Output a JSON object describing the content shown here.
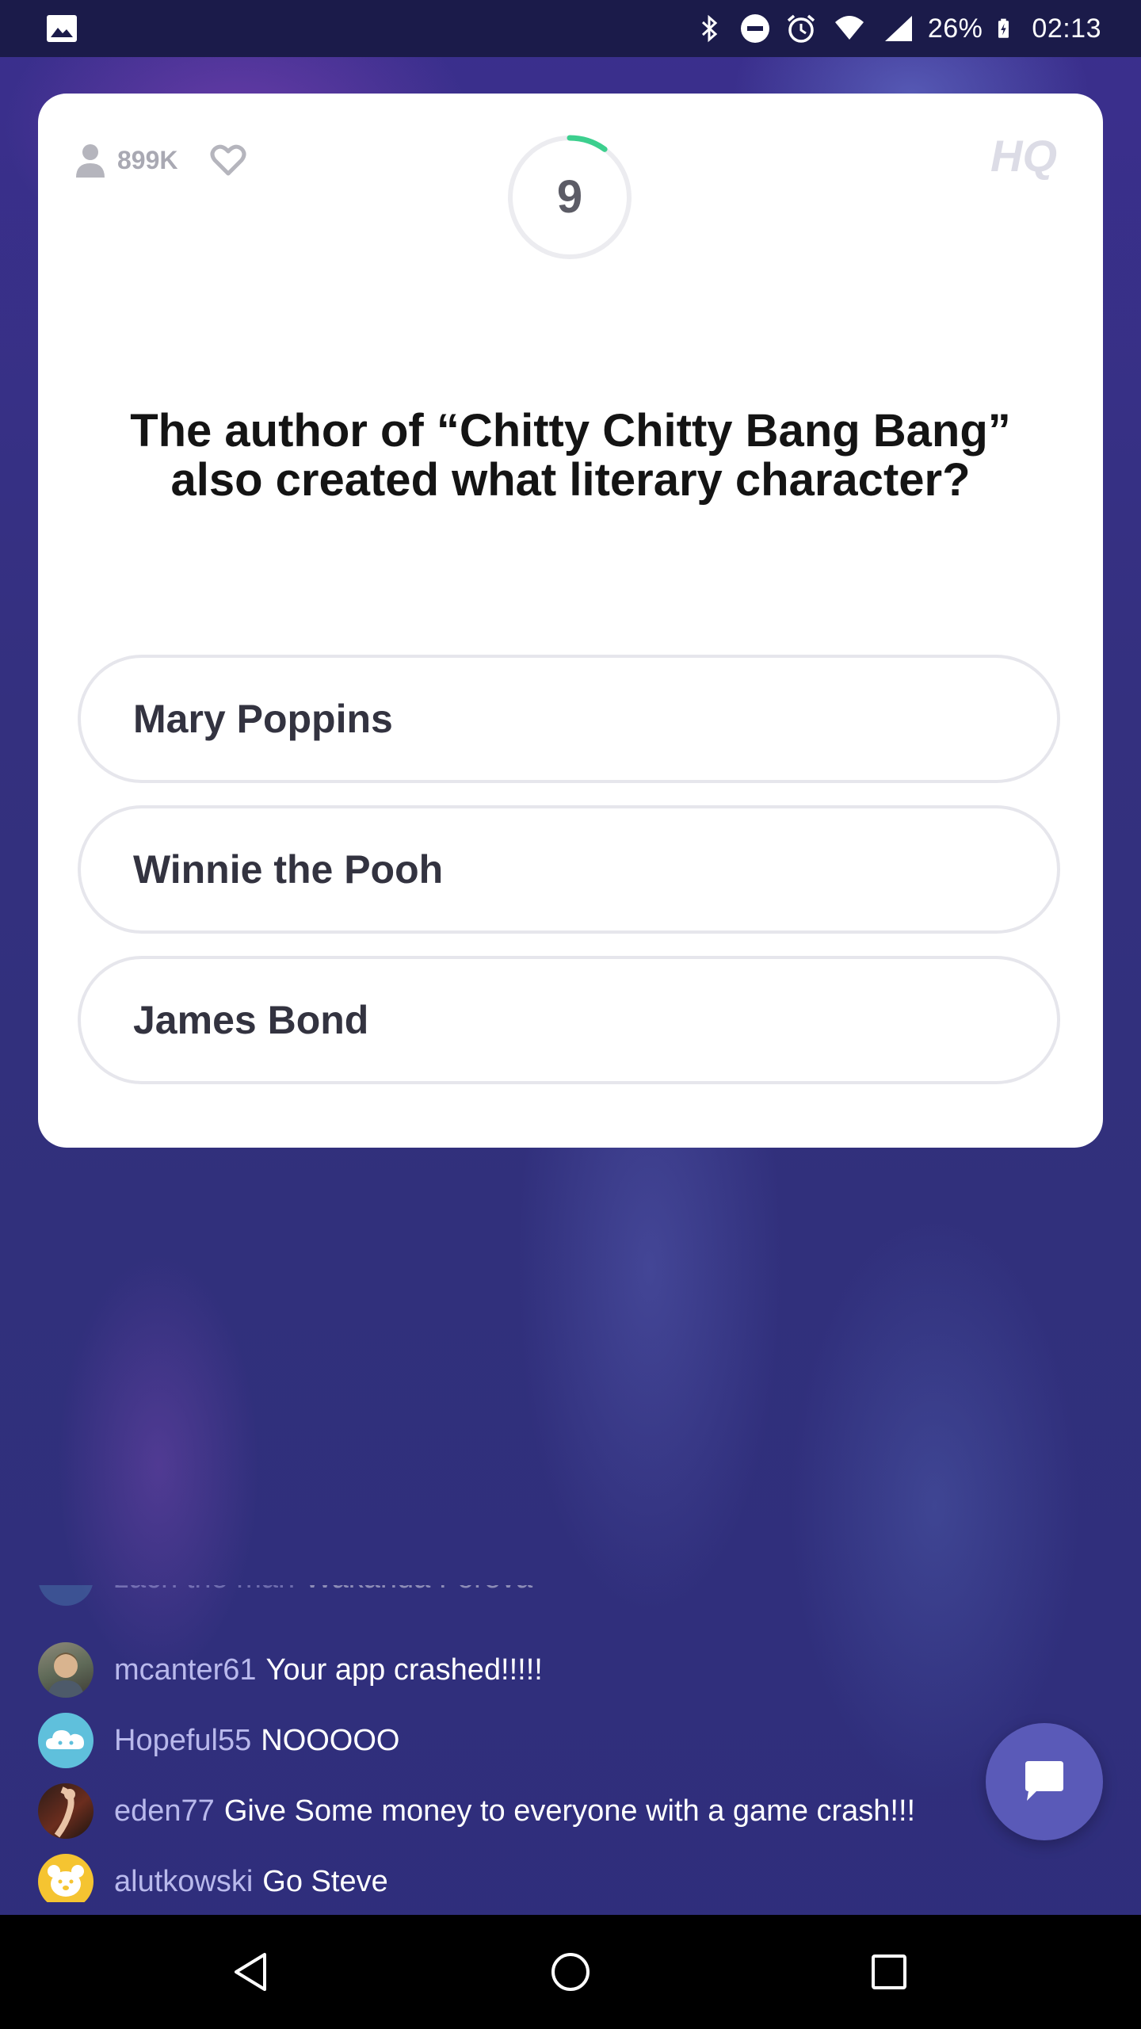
{
  "status_bar": {
    "battery_percent": "26%",
    "time": "02:13",
    "icons": [
      "gallery-icon",
      "bluetooth-icon",
      "do-not-disturb-icon",
      "alarm-icon",
      "wifi-icon",
      "cell-signal-icon",
      "battery-charging-icon"
    ]
  },
  "card": {
    "player_count": "899K",
    "timer": "9",
    "timer_progress": 0.1,
    "logo_text": "HQ",
    "question": "The author of “Chitty Chitty Bang Bang” also created what literary character?",
    "answers": [
      {
        "label": "Mary Poppins"
      },
      {
        "label": "Winnie the Pooh"
      },
      {
        "label": "James Bond"
      }
    ]
  },
  "chat": {
    "messages": [
      {
        "user": "zach the man",
        "text": "Wakanda Foreva"
      },
      {
        "user": "mcanter61",
        "text": "Your app crashed!!!!!"
      },
      {
        "user": "Hopeful55",
        "text": "NOOOOO"
      },
      {
        "user": "eden77",
        "text": "Give Some money to everyone with a game crash!!!"
      },
      {
        "user": "alutkowski",
        "text": "Go Steve"
      }
    ]
  },
  "colors": {
    "timer_accent": "#3ccf8e",
    "background": "#2f2e7e",
    "chat_button": "#5a5ab8",
    "username": "#b9b9ec"
  }
}
